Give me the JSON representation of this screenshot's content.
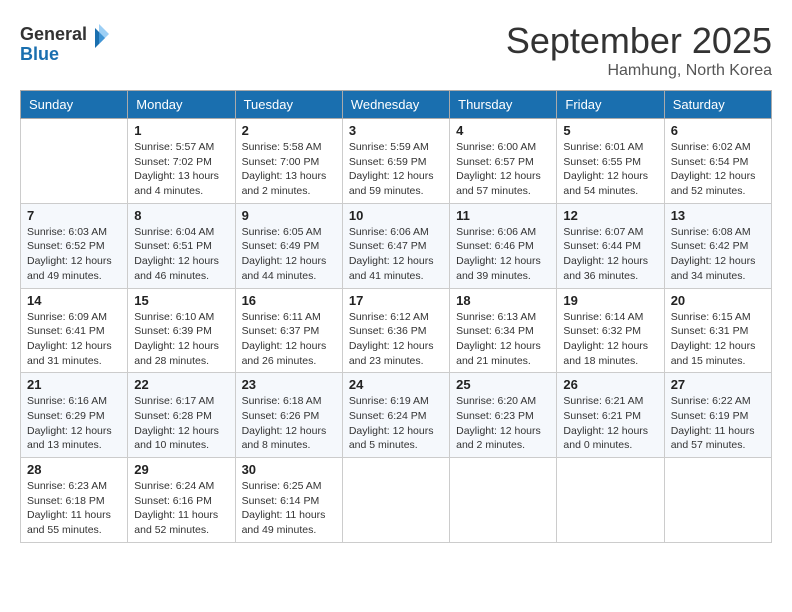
{
  "header": {
    "logo_line1": "General",
    "logo_line2": "Blue",
    "month": "September 2025",
    "location": "Hamhung, North Korea"
  },
  "days_of_week": [
    "Sunday",
    "Monday",
    "Tuesday",
    "Wednesday",
    "Thursday",
    "Friday",
    "Saturday"
  ],
  "weeks": [
    [
      {
        "day": "",
        "info": ""
      },
      {
        "day": "1",
        "info": "Sunrise: 5:57 AM\nSunset: 7:02 PM\nDaylight: 13 hours\nand 4 minutes."
      },
      {
        "day": "2",
        "info": "Sunrise: 5:58 AM\nSunset: 7:00 PM\nDaylight: 13 hours\nand 2 minutes."
      },
      {
        "day": "3",
        "info": "Sunrise: 5:59 AM\nSunset: 6:59 PM\nDaylight: 12 hours\nand 59 minutes."
      },
      {
        "day": "4",
        "info": "Sunrise: 6:00 AM\nSunset: 6:57 PM\nDaylight: 12 hours\nand 57 minutes."
      },
      {
        "day": "5",
        "info": "Sunrise: 6:01 AM\nSunset: 6:55 PM\nDaylight: 12 hours\nand 54 minutes."
      },
      {
        "day": "6",
        "info": "Sunrise: 6:02 AM\nSunset: 6:54 PM\nDaylight: 12 hours\nand 52 minutes."
      }
    ],
    [
      {
        "day": "7",
        "info": "Sunrise: 6:03 AM\nSunset: 6:52 PM\nDaylight: 12 hours\nand 49 minutes."
      },
      {
        "day": "8",
        "info": "Sunrise: 6:04 AM\nSunset: 6:51 PM\nDaylight: 12 hours\nand 46 minutes."
      },
      {
        "day": "9",
        "info": "Sunrise: 6:05 AM\nSunset: 6:49 PM\nDaylight: 12 hours\nand 44 minutes."
      },
      {
        "day": "10",
        "info": "Sunrise: 6:06 AM\nSunset: 6:47 PM\nDaylight: 12 hours\nand 41 minutes."
      },
      {
        "day": "11",
        "info": "Sunrise: 6:06 AM\nSunset: 6:46 PM\nDaylight: 12 hours\nand 39 minutes."
      },
      {
        "day": "12",
        "info": "Sunrise: 6:07 AM\nSunset: 6:44 PM\nDaylight: 12 hours\nand 36 minutes."
      },
      {
        "day": "13",
        "info": "Sunrise: 6:08 AM\nSunset: 6:42 PM\nDaylight: 12 hours\nand 34 minutes."
      }
    ],
    [
      {
        "day": "14",
        "info": "Sunrise: 6:09 AM\nSunset: 6:41 PM\nDaylight: 12 hours\nand 31 minutes."
      },
      {
        "day": "15",
        "info": "Sunrise: 6:10 AM\nSunset: 6:39 PM\nDaylight: 12 hours\nand 28 minutes."
      },
      {
        "day": "16",
        "info": "Sunrise: 6:11 AM\nSunset: 6:37 PM\nDaylight: 12 hours\nand 26 minutes."
      },
      {
        "day": "17",
        "info": "Sunrise: 6:12 AM\nSunset: 6:36 PM\nDaylight: 12 hours\nand 23 minutes."
      },
      {
        "day": "18",
        "info": "Sunrise: 6:13 AM\nSunset: 6:34 PM\nDaylight: 12 hours\nand 21 minutes."
      },
      {
        "day": "19",
        "info": "Sunrise: 6:14 AM\nSunset: 6:32 PM\nDaylight: 12 hours\nand 18 minutes."
      },
      {
        "day": "20",
        "info": "Sunrise: 6:15 AM\nSunset: 6:31 PM\nDaylight: 12 hours\nand 15 minutes."
      }
    ],
    [
      {
        "day": "21",
        "info": "Sunrise: 6:16 AM\nSunset: 6:29 PM\nDaylight: 12 hours\nand 13 minutes."
      },
      {
        "day": "22",
        "info": "Sunrise: 6:17 AM\nSunset: 6:28 PM\nDaylight: 12 hours\nand 10 minutes."
      },
      {
        "day": "23",
        "info": "Sunrise: 6:18 AM\nSunset: 6:26 PM\nDaylight: 12 hours\nand 8 minutes."
      },
      {
        "day": "24",
        "info": "Sunrise: 6:19 AM\nSunset: 6:24 PM\nDaylight: 12 hours\nand 5 minutes."
      },
      {
        "day": "25",
        "info": "Sunrise: 6:20 AM\nSunset: 6:23 PM\nDaylight: 12 hours\nand 2 minutes."
      },
      {
        "day": "26",
        "info": "Sunrise: 6:21 AM\nSunset: 6:21 PM\nDaylight: 12 hours\nand 0 minutes."
      },
      {
        "day": "27",
        "info": "Sunrise: 6:22 AM\nSunset: 6:19 PM\nDaylight: 11 hours\nand 57 minutes."
      }
    ],
    [
      {
        "day": "28",
        "info": "Sunrise: 6:23 AM\nSunset: 6:18 PM\nDaylight: 11 hours\nand 55 minutes."
      },
      {
        "day": "29",
        "info": "Sunrise: 6:24 AM\nSunset: 6:16 PM\nDaylight: 11 hours\nand 52 minutes."
      },
      {
        "day": "30",
        "info": "Sunrise: 6:25 AM\nSunset: 6:14 PM\nDaylight: 11 hours\nand 49 minutes."
      },
      {
        "day": "",
        "info": ""
      },
      {
        "day": "",
        "info": ""
      },
      {
        "day": "",
        "info": ""
      },
      {
        "day": "",
        "info": ""
      }
    ]
  ]
}
